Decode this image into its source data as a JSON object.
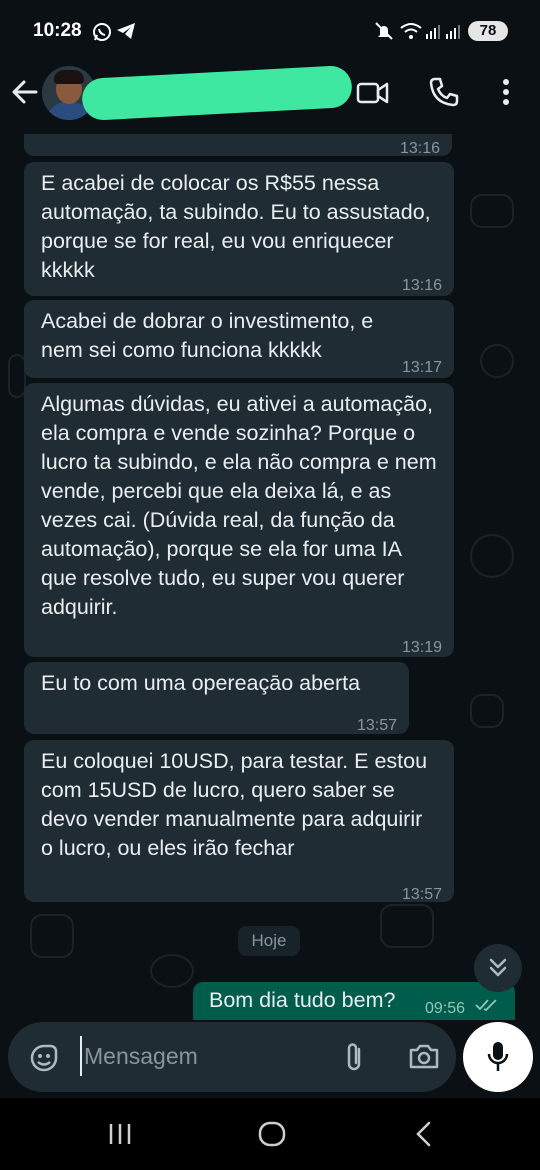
{
  "status_bar": {
    "time": "10:28",
    "battery": "78"
  },
  "header": {
    "contact_name": "",
    "icons": [
      "back-arrow-icon",
      "video-call-icon",
      "voice-call-icon",
      "more-vert-icon"
    ]
  },
  "messages": [
    {
      "direction": "in",
      "text": "",
      "time": "13:16"
    },
    {
      "direction": "in",
      "text": "E acabei de colocar os R$55 nessa automação, ta subindo. Eu to assustado, porque se for real, eu vou enriquecer kkkkk",
      "time": "13:16"
    },
    {
      "direction": "in",
      "text": "Acabei de dobrar o investimento, e nem sei como funciona kkkkk",
      "time": "13:17"
    },
    {
      "direction": "in",
      "text": "Algumas dúvidas, eu ativei a automação, ela compra e vende sozinha? Porque o lucro ta subindo, e ela não compra e nem vende, percebi que ela deixa lá, e as vezes cai. (Dúvida real, da função da automação), porque se ela for uma IA que resolve tudo, eu super vou querer adquirir.",
      "time": "13:19"
    },
    {
      "direction": "in",
      "text": "Eu to com uma opereaçāo aberta",
      "time": "13:57"
    },
    {
      "direction": "in",
      "text": "Eu coloquei 10USD, para testar. E estou com 15USD de lucro, quero saber se devo vender manualmente para adquirir o lucro, ou eles irão fechar",
      "time": "13:57"
    }
  ],
  "date_separator": "Hoje",
  "outgoing": {
    "text": "Bom dia tudo bem?",
    "time": "09:56",
    "status": "delivered"
  },
  "input": {
    "placeholder": "Mensagem",
    "value": ""
  },
  "colors": {
    "background": "#0b1014",
    "incoming_bubble": "#1f2c33",
    "outgoing_bubble": "#005c4b",
    "timestamp": "#8696a0",
    "redaction": "#3ee8a0"
  }
}
